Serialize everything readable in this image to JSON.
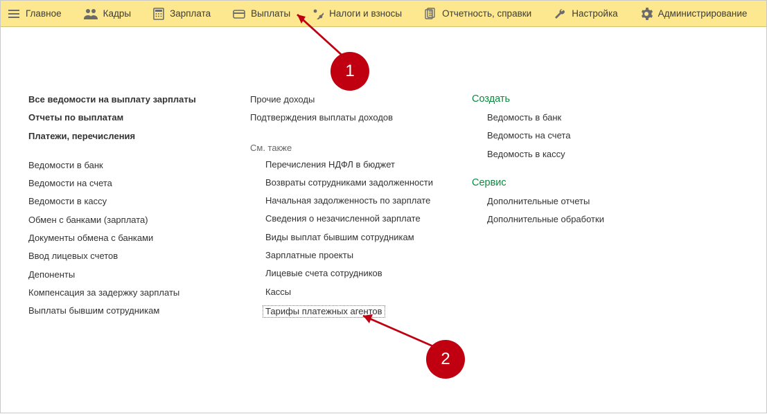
{
  "topnav": {
    "items": [
      {
        "label": "Главное"
      },
      {
        "label": "Кадры"
      },
      {
        "label": "Зарплата"
      },
      {
        "label": "Выплаты"
      },
      {
        "label": "Налоги и взносы"
      },
      {
        "label": "Отчетность, справки"
      },
      {
        "label": "Настройка"
      },
      {
        "label": "Администрирование"
      }
    ]
  },
  "col_left": {
    "bold": [
      "Все ведомости на выплату зарплаты",
      "Отчеты по выплатам",
      "Платежи, перечисления"
    ],
    "items": [
      "Ведомости в банк",
      "Ведомости на счета",
      "Ведомости в кассу",
      "Обмен с банками (зарплата)",
      "Документы обмена с банками",
      "Ввод лицевых счетов",
      "Депоненты",
      "Компенсация за задержку зарплаты",
      "Выплаты бывшим сотрудникам"
    ]
  },
  "col_mid": {
    "top": [
      "Прочие доходы",
      "Подтверждения выплаты доходов"
    ],
    "see_also_label": "См. также",
    "see_also": [
      "Перечисления НДФЛ в бюджет",
      "Возвраты сотрудниками задолженности",
      "Начальная задолженность по зарплате",
      "Сведения о незачисленной зарплате",
      "Виды выплат бывшим сотрудникам",
      "Зарплатные проекты",
      "Лицевые счета сотрудников",
      "Кассы",
      "Тарифы платежных агентов"
    ]
  },
  "col_right": {
    "create_label": "Создать",
    "create": [
      "Ведомость в банк",
      "Ведомость на счета",
      "Ведомость в кассу"
    ],
    "service_label": "Сервис",
    "service": [
      "Дополнительные отчеты",
      "Дополнительные обработки"
    ]
  },
  "annotations": {
    "one": "1",
    "two": "2"
  }
}
